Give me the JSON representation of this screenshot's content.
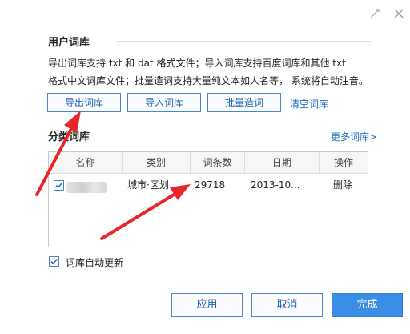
{
  "user_lib": {
    "title": "用户词库",
    "desc_line1": "导出词库支持 txt 和 dat 格式文件；导入词库支持百度词库和其他 txt",
    "desc_line2": "格式中文词库文件；批量造词支持大量纯文本如人名等， 系统将自动注音。",
    "buttons": {
      "export": "导出词库",
      "import": "导入词库",
      "batch": "批量造词",
      "clear": "清空词库"
    }
  },
  "category": {
    "title": "分类词库",
    "more": "更多词库>",
    "columns": [
      "名称",
      "类别",
      "词条数",
      "日期",
      "操作"
    ],
    "rows": [
      {
        "name": "",
        "category": "城市·区划",
        "count": "29718",
        "date": "2013-10...",
        "action": "删除",
        "checked": true
      }
    ]
  },
  "auto_update": {
    "label": "词库自动更新",
    "checked": true
  },
  "footer": {
    "apply": "应用",
    "cancel": "取消",
    "finish": "完成"
  },
  "window": {
    "settings_icon": "gear-icon",
    "close_icon": "close-icon"
  },
  "colors": {
    "accent": "#4a86c5",
    "link": "#1f6fc4",
    "primary": "#3b8ee6",
    "arrow": "#e8262a"
  }
}
